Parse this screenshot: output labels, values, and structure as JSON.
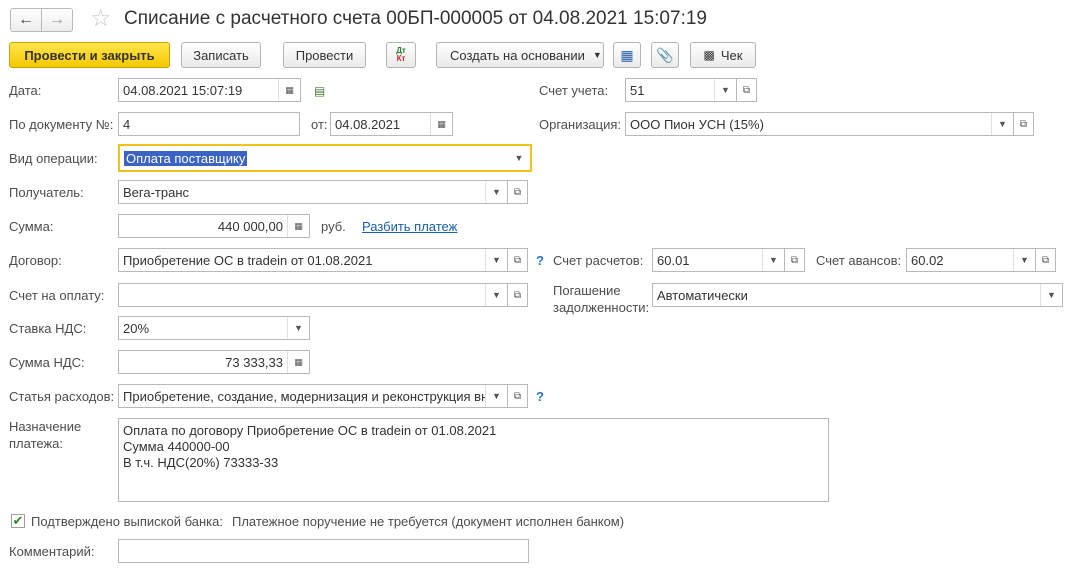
{
  "window": {
    "back_icon": "arrow-left-icon",
    "forward_icon": "arrow-right-icon",
    "favorite_icon": "star-icon",
    "title": "Списание с расчетного счета 00БП-000005 от 04.08.2021 15:07:19"
  },
  "toolbar": {
    "post_close": "Провести и закрыть",
    "save": "Записать",
    "post": "Провести",
    "dtkt_icon": "dt-kt-icon",
    "create_based": "Создать на основании",
    "structure_icon": "structure-icon",
    "attach_icon": "paperclip-icon",
    "check_label": "Чек",
    "check_icon": "printer-icon"
  },
  "form": {
    "date_label": "Дата:",
    "date_value": "04.08.2021 15:07:19",
    "account_label": "Счет учета:",
    "account_value": "51",
    "doc_no_label": "По документу №:",
    "doc_no_value": "4",
    "from_label": "от:",
    "from_value": "04.08.2021",
    "org_label": "Организация:",
    "org_value": "ООО Пион УСН (15%)",
    "op_label": "Вид операции:",
    "op_value": "Оплата поставщику",
    "recipient_label": "Получатель:",
    "recipient_value": "Вега-транс",
    "sum_label": "Сумма:",
    "sum_value": "440 000,00",
    "currency": "руб.",
    "split_link": "Разбить платеж",
    "contract_label": "Договор:",
    "contract_value": "Приобретение ОС в tradein от 01.08.2021",
    "help_mark": "?",
    "settle_acc_label": "Счет расчетов:",
    "settle_acc_value": "60.01",
    "adv_acc_label": "Счет авансов:",
    "adv_acc_value": "60.02",
    "invoice_label": "Счет на оплату:",
    "invoice_value": "",
    "repay_label_1": "Погашение",
    "repay_label_2": "задолженности:",
    "repay_value": "Автоматически",
    "vat_rate_label": "Ставка НДС:",
    "vat_rate_value": "20%",
    "vat_sum_label": "Сумма НДС:",
    "vat_sum_value": "73 333,33",
    "expense_label": "Статья расходов:",
    "expense_value": "Приобретение, создание, модернизация и реконструкция вн",
    "purpose_label_1": "Назначение",
    "purpose_label_2": "платежа:",
    "purpose_lines": [
      "Оплата по договору Приобретение ОС в tradein от 01.08.2021",
      "Сумма 440000-00",
      "В т.ч. НДС(20%) 73333-33"
    ],
    "bank_confirmed_label": "Подтверждено выпиской банка:",
    "bank_confirmed_checked": true,
    "bank_note": "Платежное поручение не требуется (документ исполнен банком)",
    "comment_label": "Комментарий:",
    "comment_value": ""
  }
}
